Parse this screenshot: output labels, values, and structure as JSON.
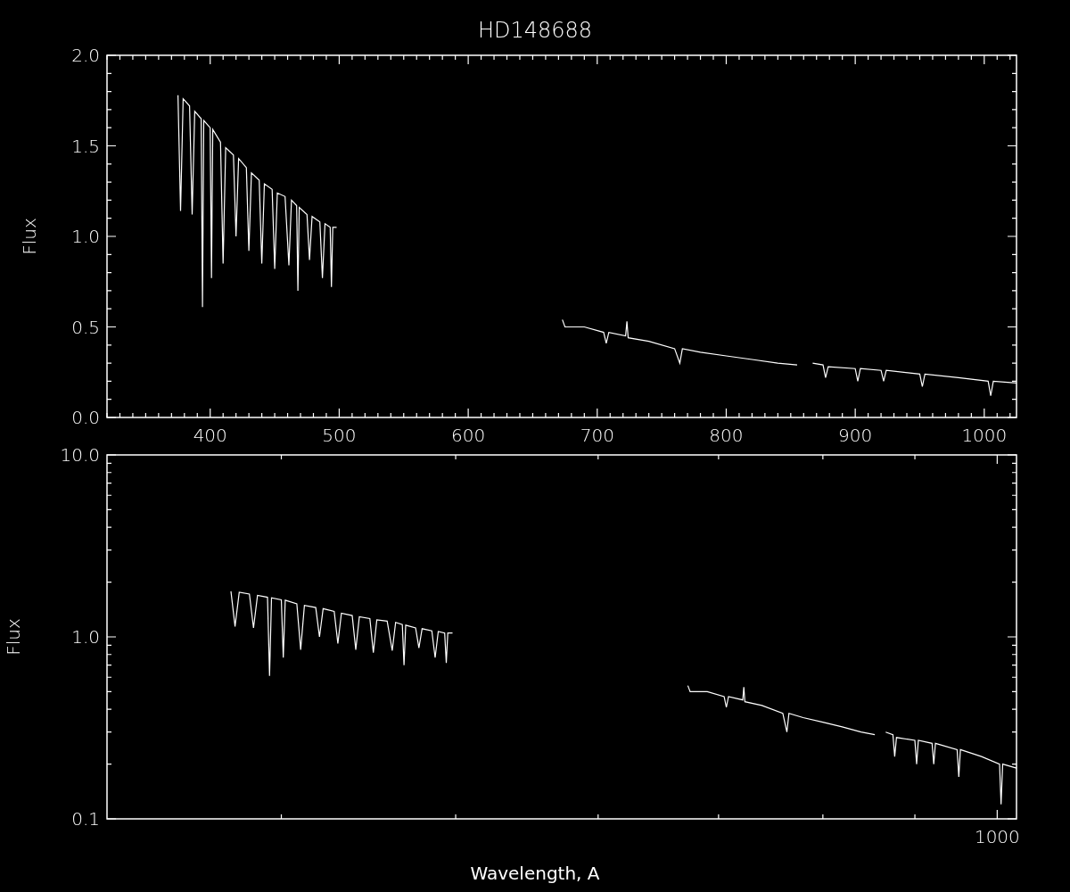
{
  "title": "HD148688",
  "linear_plot": {
    "chart_data": {
      "type": "line",
      "ylabel": "Flux",
      "xlim": [
        320,
        1025
      ],
      "ylim": [
        0,
        2
      ],
      "xticks": [
        400,
        500,
        600,
        700,
        800,
        900,
        1000
      ],
      "yticks": [
        {
          "value": 0,
          "label": "0.0"
        },
        {
          "value": 0.5,
          "label": "0.5"
        },
        {
          "value": 1,
          "label": "1.0"
        },
        {
          "value": 1.5,
          "label": "1.5"
        },
        {
          "value": 2,
          "label": "2.0"
        }
      ],
      "x": [
        375,
        377,
        379,
        384,
        386,
        388,
        393,
        394,
        395,
        400,
        401,
        402,
        408,
        410,
        412,
        418,
        420,
        422,
        428,
        430,
        432,
        438,
        440,
        442,
        448,
        450,
        452,
        458,
        461,
        463,
        467,
        468,
        469,
        475,
        477,
        479,
        485,
        487,
        489,
        493,
        494,
        495,
        498,
        500,
        673,
        675,
        690,
        705,
        707,
        709,
        722,
        723,
        724,
        740,
        760,
        764,
        766,
        780,
        800,
        820,
        840,
        855,
        860,
        867,
        875,
        877,
        879,
        900,
        902,
        904,
        920,
        922,
        924,
        950,
        952,
        954,
        980,
        1003,
        1005,
        1007,
        1025
      ],
      "series": [
        {
          "color": "#ffffff",
          "values": [
            1.78,
            1.14,
            1.76,
            1.72,
            1.12,
            1.69,
            1.65,
            0.61,
            1.64,
            1.6,
            0.77,
            1.59,
            1.52,
            0.85,
            1.49,
            1.45,
            1.0,
            1.43,
            1.38,
            0.92,
            1.35,
            1.31,
            0.85,
            1.29,
            1.26,
            0.82,
            1.24,
            1.22,
            0.84,
            1.2,
            1.17,
            0.7,
            1.16,
            1.12,
            0.87,
            1.11,
            1.08,
            0.77,
            1.07,
            1.05,
            0.72,
            1.05,
            1.05,
            null,
            0.54,
            0.5,
            0.5,
            0.47,
            0.41,
            0.47,
            0.45,
            0.53,
            0.44,
            0.42,
            0.38,
            0.3,
            0.38,
            0.36,
            0.34,
            0.32,
            0.3,
            0.29,
            null,
            0.3,
            0.29,
            0.22,
            0.28,
            0.27,
            0.2,
            0.27,
            0.26,
            0.2,
            0.26,
            0.24,
            0.17,
            0.24,
            0.22,
            0.2,
            0.12,
            0.2,
            0.19
          ]
        }
      ]
    }
  },
  "log_plot": {
    "ylabel": "Flux",
    "y_tick_labels": [
      "10.0",
      "1.0",
      "0.1"
    ],
    "x_tick_label": "1000",
    "xlabel": "Wavelength, A"
  }
}
